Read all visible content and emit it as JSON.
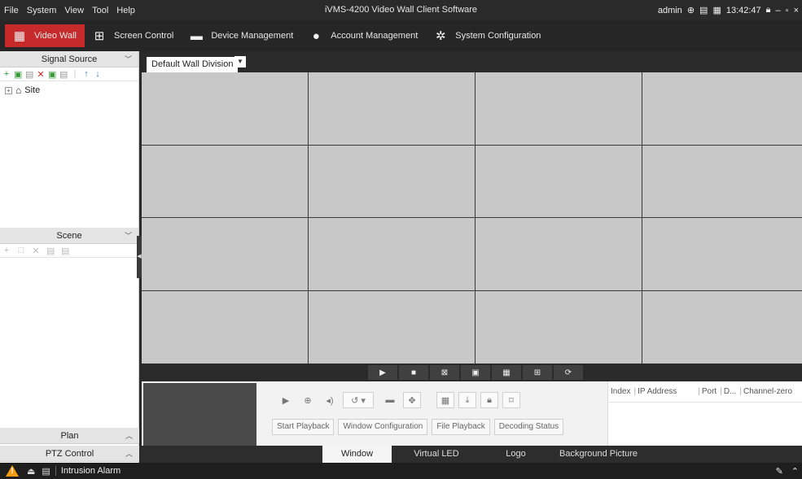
{
  "menu": [
    "File",
    "System",
    "View",
    "Tool",
    "Help"
  ],
  "app_title": "iVMS-4200 Video Wall Client Software",
  "titlebar": {
    "user": "admin",
    "time": "13:42:47"
  },
  "modules": [
    {
      "label": "Video Wall",
      "icon": "video-wall-icon",
      "active": true
    },
    {
      "label": "Screen Control",
      "icon": "screen-control-icon"
    },
    {
      "label": "Device Management",
      "icon": "device-icon"
    },
    {
      "label": "Account Management",
      "icon": "account-icon"
    },
    {
      "label": "System Configuration",
      "icon": "gear-icon"
    }
  ],
  "left": {
    "signal_source": "Signal Source",
    "site": "Site",
    "scene": "Scene",
    "plan": "Plan",
    "ptz": "PTZ Control"
  },
  "wall": {
    "division": "Default Wall Division",
    "columns": 4,
    "rows": 4
  },
  "bottom": {
    "buttons": [
      "Start Playback",
      "Window Configuration",
      "File Playback",
      "Decoding Status"
    ],
    "table_headers": [
      "Index",
      "IP Address",
      "Port",
      "D...",
      "Channel-zero"
    ],
    "tabs": [
      "Window",
      "Virtual LED",
      "Logo",
      "Background Picture"
    ]
  },
  "status": {
    "alarm": "Intrusion Alarm"
  },
  "colors": {
    "accent": "#c62a2a",
    "dark": "#2a2a2a",
    "cell": "#c8c8c8"
  }
}
